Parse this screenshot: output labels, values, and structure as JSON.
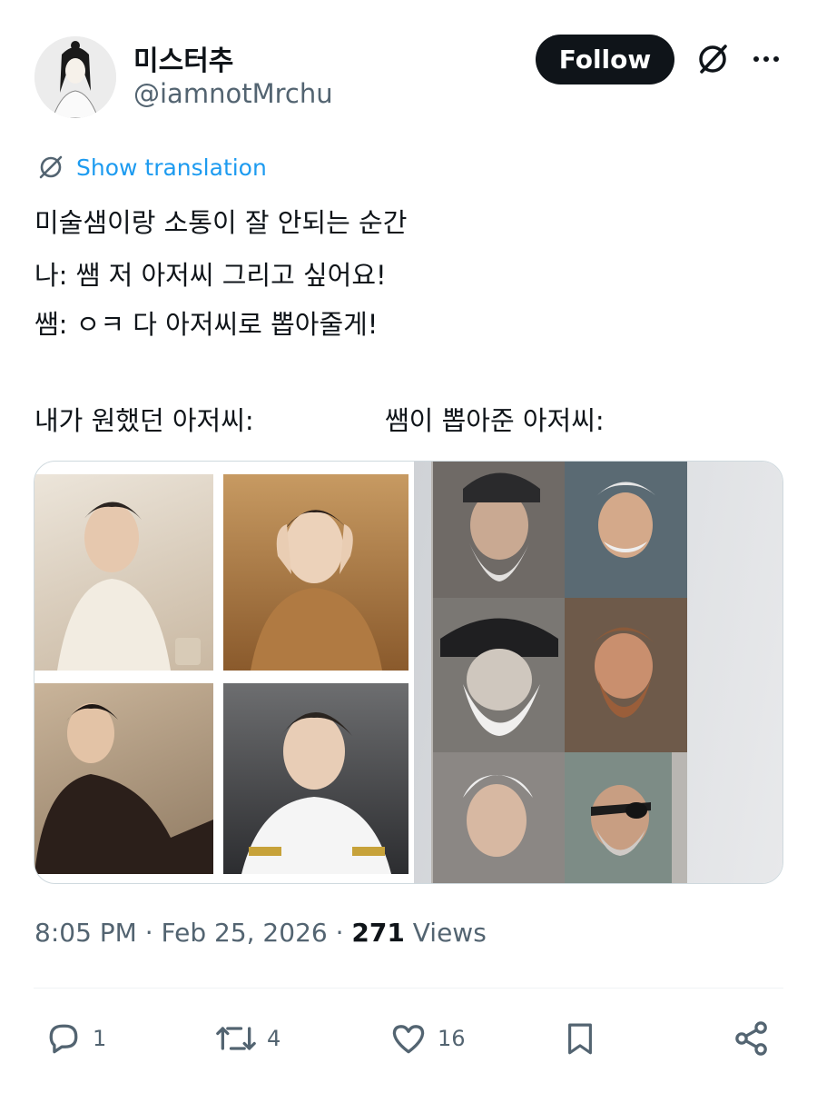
{
  "author": {
    "display_name": "미스터추",
    "handle": "@iamnotMrchu"
  },
  "header": {
    "follow_label": "Follow"
  },
  "translation": {
    "label": "Show translation"
  },
  "tweet": {
    "lines": [
      "미술샘이랑 소통이 잘 안되는 순간",
      "나: 쌤 저 아저씨 그리고 싶어요!",
      "쌤: ㅇㅋ 다 아저씨로 뽑아줄게!",
      "내가 원했던 아저씨:",
      "쌤이 뽑아준 아저씨:"
    ]
  },
  "meta": {
    "time": "8:05 PM",
    "separator": " · ",
    "date": "Feb 25, 2026",
    "views_count": "271",
    "views_label": "Views"
  },
  "actions": {
    "replies": "1",
    "reposts": "4",
    "likes": "16"
  },
  "icons": [
    "grok-icon",
    "more-icon",
    "reply-icon",
    "repost-icon",
    "like-icon",
    "bookmark-icon",
    "share-icon"
  ],
  "colors": {
    "link": "#1d9bf0",
    "secondary_text": "#536471",
    "primary_text": "#0f1419",
    "follow_button": "#0f1419"
  }
}
